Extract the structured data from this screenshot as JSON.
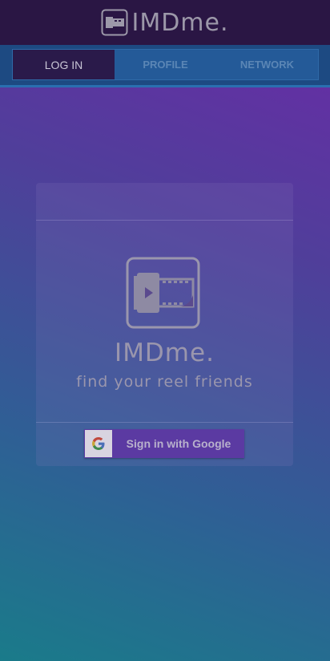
{
  "header": {
    "brand": "IMDme.",
    "brand_icon": "film-reel-icon"
  },
  "tabs": [
    {
      "label": "LOG IN",
      "active": true
    },
    {
      "label": "PROFILE",
      "active": false
    },
    {
      "label": "NETWORK",
      "active": false
    }
  ],
  "card": {
    "logo_icon": "film-camera-icon",
    "title": "IMDme.",
    "tagline": "find your reel friends",
    "signin_label": "Sign in with Google",
    "signin_icon": "google-g-icon"
  }
}
